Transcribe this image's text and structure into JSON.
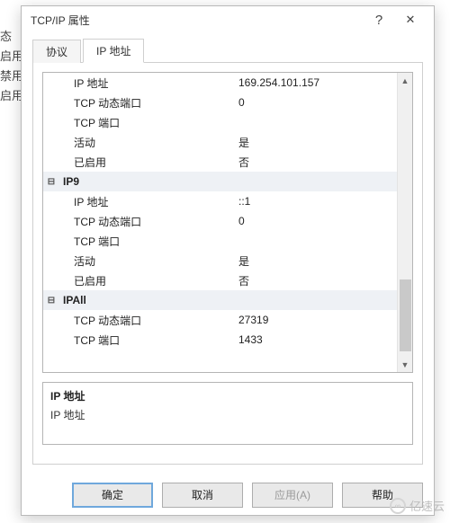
{
  "behind": {
    "lines": [
      "态",
      "启用",
      "禁用",
      "启用"
    ]
  },
  "dialog": {
    "title": "TCP/IP 属性",
    "help": "?",
    "close": "✕"
  },
  "tabs": {
    "protocol": "协议",
    "ipaddr": "IP 地址"
  },
  "grid": {
    "rows": [
      {
        "type": "row",
        "label": "IP 地址",
        "value": "169.254.101.157",
        "indent": true
      },
      {
        "type": "row",
        "label": "TCP 动态端口",
        "value": "0",
        "indent": true
      },
      {
        "type": "row",
        "label": "TCP 端口",
        "value": "",
        "indent": true
      },
      {
        "type": "row",
        "label": "活动",
        "value": "是",
        "indent": true
      },
      {
        "type": "row",
        "label": "已启用",
        "value": "否",
        "indent": true
      },
      {
        "type": "section",
        "label": "IP9",
        "value": ""
      },
      {
        "type": "row",
        "label": "IP 地址",
        "value": "::1",
        "indent": true
      },
      {
        "type": "row",
        "label": "TCP 动态端口",
        "value": "0",
        "indent": true
      },
      {
        "type": "row",
        "label": "TCP 端口",
        "value": "",
        "indent": true
      },
      {
        "type": "row",
        "label": "活动",
        "value": "是",
        "indent": true
      },
      {
        "type": "row",
        "label": "已启用",
        "value": "否",
        "indent": true
      },
      {
        "type": "section",
        "label": "IPAll",
        "value": ""
      },
      {
        "type": "row",
        "label": "TCP 动态端口",
        "value": "27319",
        "indent": true
      },
      {
        "type": "row",
        "label": "TCP 端口",
        "value": "1433",
        "indent": true
      }
    ]
  },
  "desc": {
    "heading": "IP 地址",
    "body": "IP 地址"
  },
  "buttons": {
    "ok": "确定",
    "cancel": "取消",
    "apply": "应用(A)",
    "help": "帮助"
  },
  "watermark": "亿速云"
}
